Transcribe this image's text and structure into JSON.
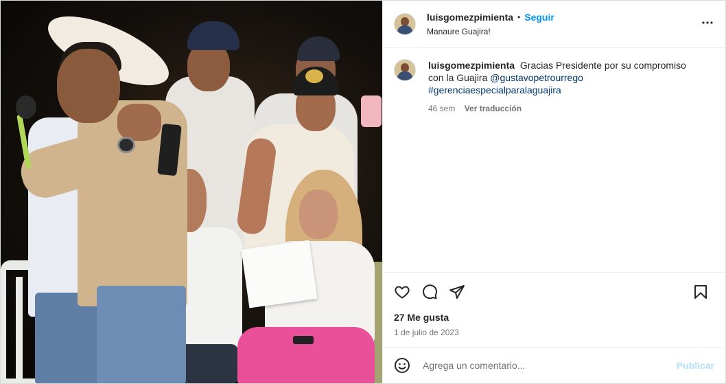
{
  "header": {
    "username": "luisgomezpimienta",
    "separator": "•",
    "follow_label": "Seguir",
    "location": "Manaure Guajira!",
    "more_icon": "more-options-icon"
  },
  "caption": {
    "username": "luisgomezpimienta",
    "text": "Gracias Presidente por su compromiso con la Guajira",
    "mention": "@gustavopetrourrego",
    "hashtag": "#gerenciaespecialparalaguajira",
    "time_ago": "46 sem",
    "translate_label": "Ver traducción"
  },
  "actions": {
    "like_icon": "heart-icon",
    "comment_icon": "comment-icon",
    "share_icon": "share-icon",
    "save_icon": "bookmark-icon"
  },
  "likes": "27 Me gusta",
  "date": "1 de julio de 2023",
  "comment_box": {
    "emoji_icon": "emoji-icon",
    "placeholder": "Agrega un comentario...",
    "publish_label": "Publicar"
  },
  "colors": {
    "link_blue": "#0095f6",
    "tag_blue": "#00376b",
    "publish_disabled": "#b2dffc",
    "secondary_text": "#737373"
  }
}
